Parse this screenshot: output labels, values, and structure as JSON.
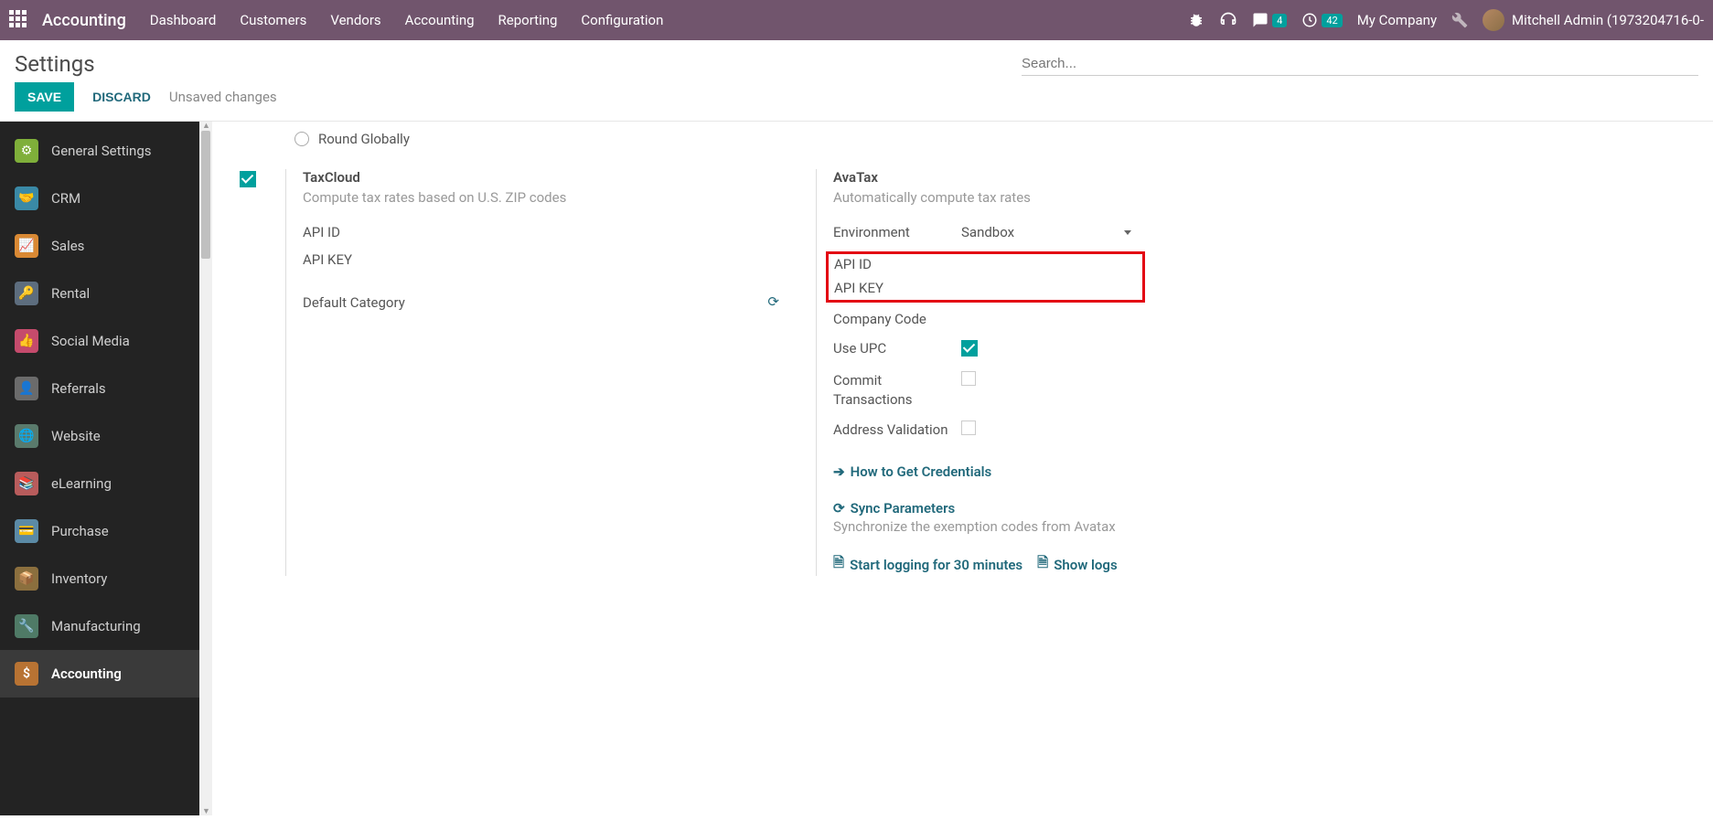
{
  "navbar": {
    "brand": "Accounting",
    "menu": [
      "Dashboard",
      "Customers",
      "Vendors",
      "Accounting",
      "Reporting",
      "Configuration"
    ],
    "msg_badge": "4",
    "clock_badge": "42",
    "company": "My Company",
    "user": "Mitchell Admin (1973204716-0-"
  },
  "header": {
    "title": "Settings",
    "save": "SAVE",
    "discard": "DISCARD",
    "unsaved": "Unsaved changes",
    "search_placeholder": "Search..."
  },
  "sidebar": {
    "items": [
      {
        "label": "General Settings",
        "color": "#7FAF3A"
      },
      {
        "label": "CRM",
        "color": "#3A89A6"
      },
      {
        "label": "Sales",
        "color": "#D98934"
      },
      {
        "label": "Rental",
        "color": "#5D6D7E"
      },
      {
        "label": "Social Media",
        "color": "#C54B6C"
      },
      {
        "label": "Referrals",
        "color": "#6B6B6B"
      },
      {
        "label": "Website",
        "color": "#5A7A6C"
      },
      {
        "label": "eLearning",
        "color": "#B85C5C"
      },
      {
        "label": "Purchase",
        "color": "#5B8AA6"
      },
      {
        "label": "Inventory",
        "color": "#8B6F3E"
      },
      {
        "label": "Manufacturing",
        "color": "#4F7A66"
      },
      {
        "label": "Accounting",
        "color": "#B87333",
        "active": true
      }
    ]
  },
  "content": {
    "round_globally": "Round Globally",
    "taxcloud": {
      "title": "TaxCloud",
      "desc": "Compute tax rates based on U.S. ZIP codes",
      "api_id": "API ID",
      "api_key": "API KEY",
      "default_category": "Default Category"
    },
    "avatax": {
      "title": "AvaTax",
      "desc": "Automatically compute tax rates",
      "environment_label": "Environment",
      "environment_value": "Sandbox",
      "api_id": "API ID",
      "api_key": "API KEY",
      "company_code": "Company Code",
      "use_upc": "Use UPC",
      "commit_transactions": "Commit Transactions",
      "address_validation": "Address Validation",
      "how_to": "How to Get Credentials",
      "sync_params": "Sync Parameters",
      "sync_desc": "Synchronize the exemption codes from Avatax",
      "start_logging": "Start logging for 30 minutes",
      "show_logs": "Show logs"
    }
  }
}
